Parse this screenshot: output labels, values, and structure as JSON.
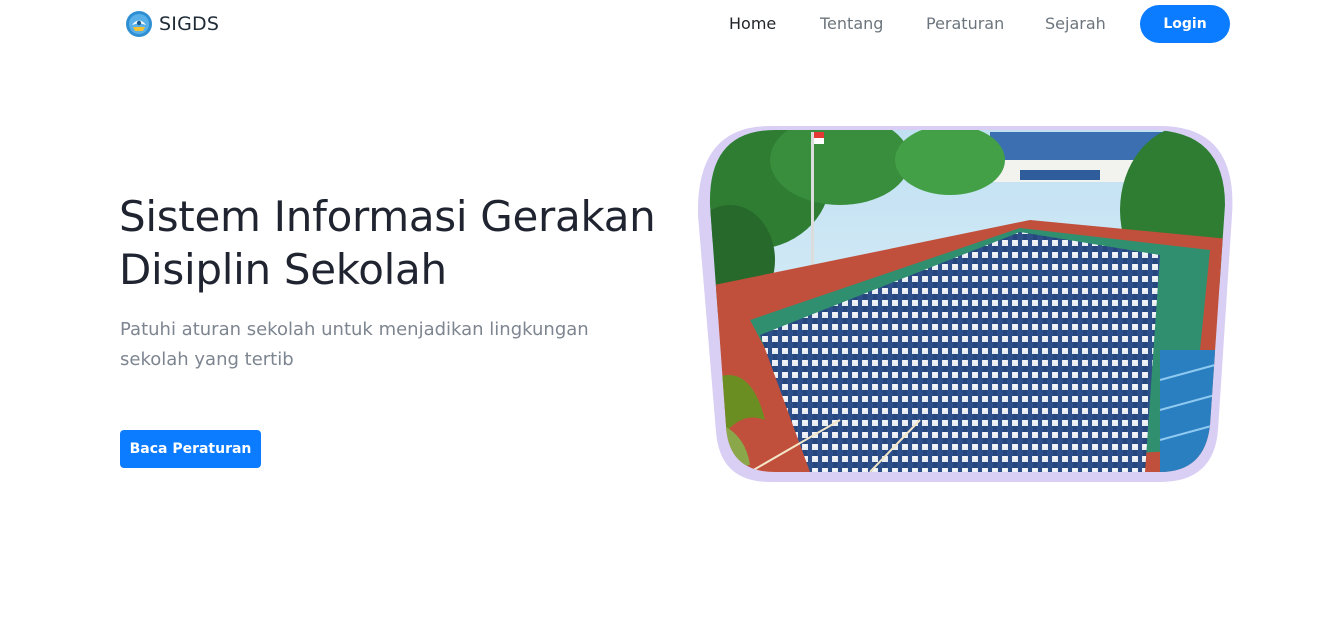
{
  "brand": {
    "name": "SIGDS",
    "logo_icon": "tut-wuri-handayani-logo-icon"
  },
  "nav": {
    "items": [
      {
        "label": "Home",
        "active": true
      },
      {
        "label": "Tentang",
        "active": false
      },
      {
        "label": "Peraturan",
        "active": false
      },
      {
        "label": "Sejarah",
        "active": false
      }
    ],
    "login_label": "Login"
  },
  "hero": {
    "title": "Sistem Informasi Gerakan Disiplin Sekolah",
    "subtitle": "Patuhi aturan sekolah untuk menjadikan lingkungan sekolah yang tertib",
    "cta_label": "Baca Peraturan",
    "image_subject": "students-assembly-photo"
  },
  "colors": {
    "primary": "#0b7bff",
    "frame": "#d9cff5",
    "text_dark": "#1f2430",
    "text_muted": "#7d8590"
  }
}
